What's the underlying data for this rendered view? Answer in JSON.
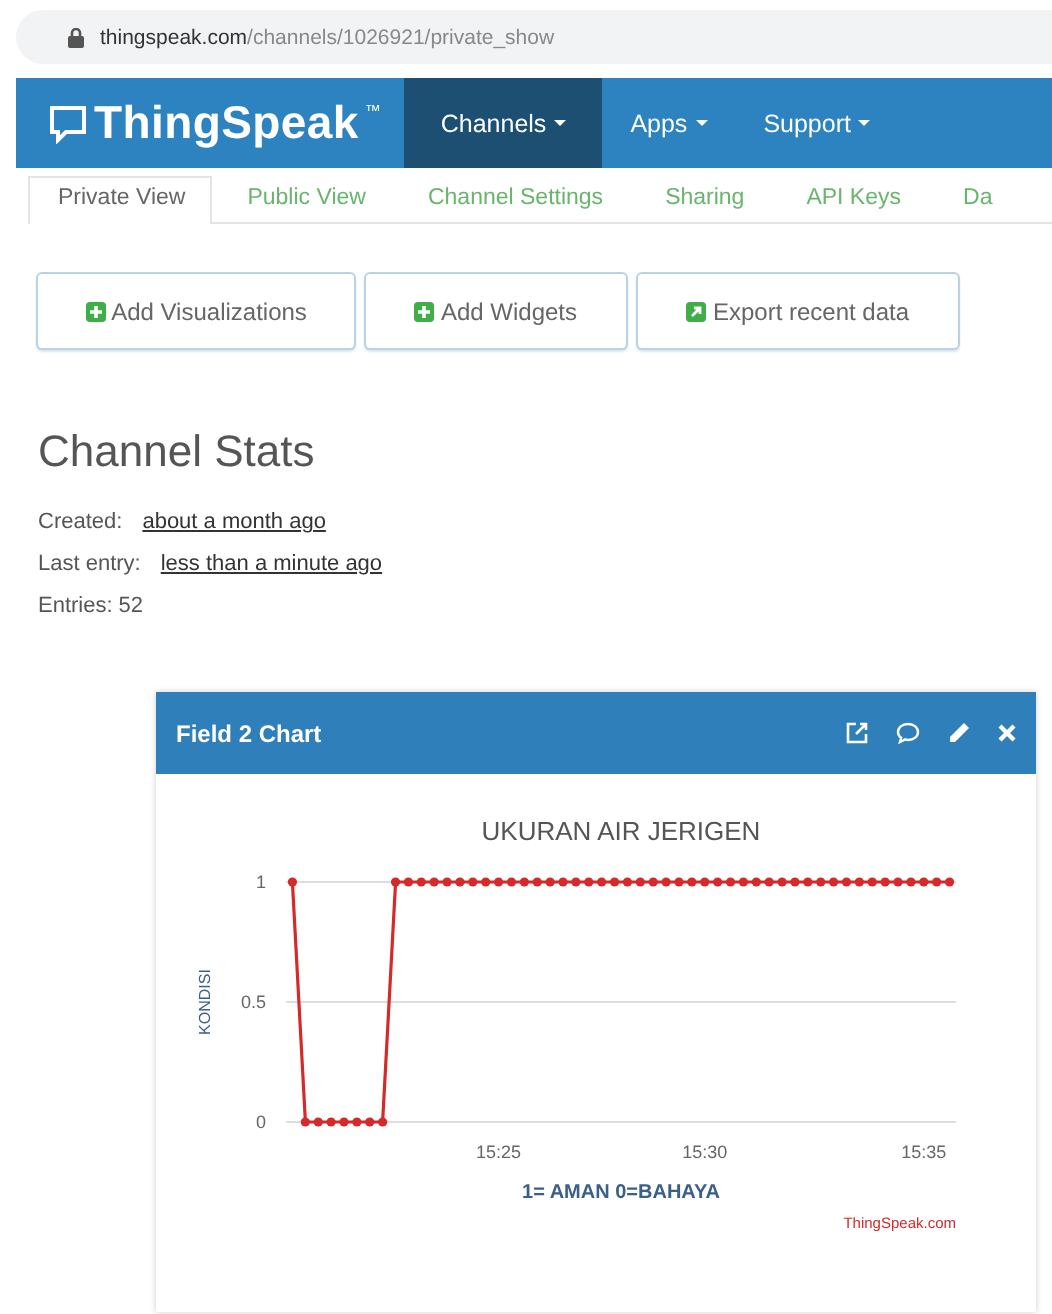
{
  "browser": {
    "url_host": "thingspeak.com",
    "url_path": "/channels/1026921/private_show"
  },
  "navbar": {
    "brand": "ThingSpeak",
    "trademark": "™",
    "menus": [
      {
        "label": "Channels",
        "selected": true
      },
      {
        "label": "Apps",
        "selected": false
      },
      {
        "label": "Support",
        "selected": false
      }
    ]
  },
  "tabs": [
    {
      "label": "Private View",
      "selected": true
    },
    {
      "label": "Public View",
      "selected": false
    },
    {
      "label": "Channel Settings",
      "selected": false
    },
    {
      "label": "Sharing",
      "selected": false
    },
    {
      "label": "API Keys",
      "selected": false
    },
    {
      "label": "Da",
      "selected": false
    }
  ],
  "actions": [
    {
      "label": "Add Visualizations",
      "kind": "add"
    },
    {
      "label": "Add Widgets",
      "kind": "add"
    },
    {
      "label": "Export recent data",
      "kind": "export"
    }
  ],
  "stats": {
    "title": "Channel Stats",
    "rows": [
      {
        "label": "Created:",
        "value": "about a month ago",
        "kind": "link"
      },
      {
        "label": "Last entry:",
        "value": "less than a minute ago",
        "kind": "link"
      },
      {
        "label": "Entries:",
        "value": "52",
        "kind": "plain"
      }
    ]
  },
  "chart_card": {
    "title": "Field 2 Chart",
    "credit": "ThingSpeak.com",
    "chart_data": {
      "type": "line",
      "title": "UKURAN AIR JERIGEN",
      "xlabel": "1= AMAN 0=BAHAYA",
      "ylabel": "KONDISI",
      "categories": [
        null,
        null,
        null,
        null,
        null,
        null,
        null,
        null,
        null,
        null,
        null,
        null,
        null,
        null,
        null,
        null,
        "15:25",
        null,
        null,
        null,
        null,
        null,
        null,
        null,
        null,
        null,
        null,
        null,
        null,
        null,
        null,
        null,
        "15:30",
        null,
        null,
        null,
        null,
        null,
        null,
        null,
        null,
        null,
        null,
        null,
        null,
        null,
        null,
        null,
        null,
        "15:35",
        null,
        null
      ],
      "series": [
        {
          "color": "#d42a2a",
          "marker": "circle",
          "values": [
            1,
            0,
            0,
            0,
            0,
            0,
            0,
            0,
            1,
            1,
            1,
            1,
            1,
            1,
            1,
            1,
            1,
            1,
            1,
            1,
            1,
            1,
            1,
            1,
            1,
            1,
            1,
            1,
            1,
            1,
            1,
            1,
            1,
            1,
            1,
            1,
            1,
            1,
            1,
            1,
            1,
            1,
            1,
            1,
            1,
            1,
            1,
            1,
            1,
            1,
            1,
            1
          ]
        }
      ],
      "ylim": [
        0,
        1
      ],
      "yticks": [
        0,
        0.5,
        1
      ]
    }
  }
}
